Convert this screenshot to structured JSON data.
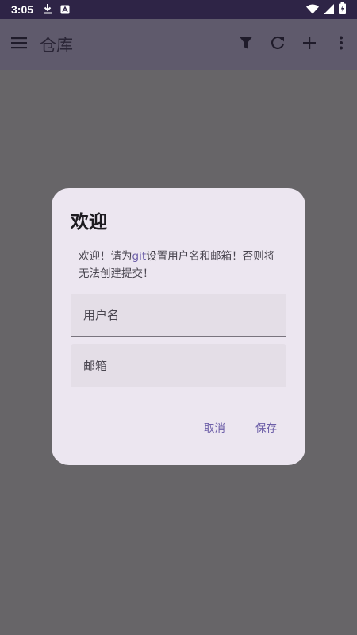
{
  "status_bar": {
    "time": "3:05",
    "icons": [
      "download-icon",
      "app-notification-icon",
      "wifi-icon",
      "signal-icon",
      "battery-icon"
    ]
  },
  "app_bar": {
    "title": "仓库",
    "menu_icon": "menu-icon",
    "actions": [
      "filter-icon",
      "refresh-icon",
      "add-icon",
      "more-vert-icon"
    ]
  },
  "dialog": {
    "title": "欢迎",
    "message_part1": "欢迎！请为",
    "message_highlight": "git",
    "message_part2": "设置用户名和邮箱！否则将无法创建提交！",
    "username_placeholder": "用户名",
    "email_placeholder": "邮箱",
    "cancel_label": "取消",
    "save_label": "保存"
  },
  "colors": {
    "status_bar": "#2e2446",
    "app_bar": "#5f5a6c",
    "scrim_background": "#676568",
    "dialog_surface": "#ece6f0",
    "field_fill": "#e4dee7",
    "accent": "#6d5fa8"
  }
}
